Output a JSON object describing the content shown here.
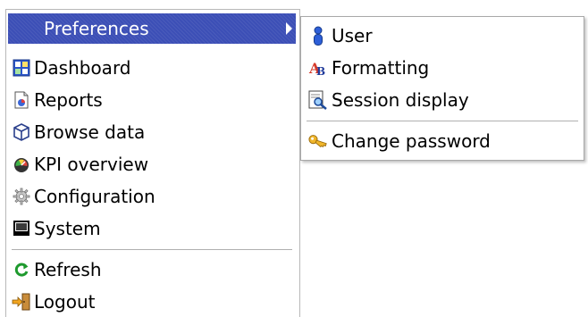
{
  "menu": {
    "items": [
      {
        "label": "Preferences",
        "icon": "none"
      },
      {
        "label": "Dashboard",
        "icon": "dashboard-grid-icon"
      },
      {
        "label": "Reports",
        "icon": "report-document-icon"
      },
      {
        "label": "Browse data",
        "icon": "cube-icon"
      },
      {
        "label": "KPI overview",
        "icon": "gauge-icon"
      },
      {
        "label": "Configuration",
        "icon": "gear-icon"
      },
      {
        "label": "System",
        "icon": "monitor-icon"
      },
      {
        "label": "Refresh",
        "icon": "refresh-icon"
      },
      {
        "label": "Logout",
        "icon": "logout-door-icon"
      }
    ]
  },
  "submenu": {
    "items": [
      {
        "label": "User",
        "icon": "user-icon"
      },
      {
        "label": "Formatting",
        "icon": "formatting-icon"
      },
      {
        "label": "Session display",
        "icon": "session-display-icon"
      },
      {
        "label": "Change password",
        "icon": "key-icon"
      }
    ]
  },
  "colors": {
    "highlight": "#3c4fb6",
    "separator": "#b0b0b0",
    "text": "#000000"
  }
}
